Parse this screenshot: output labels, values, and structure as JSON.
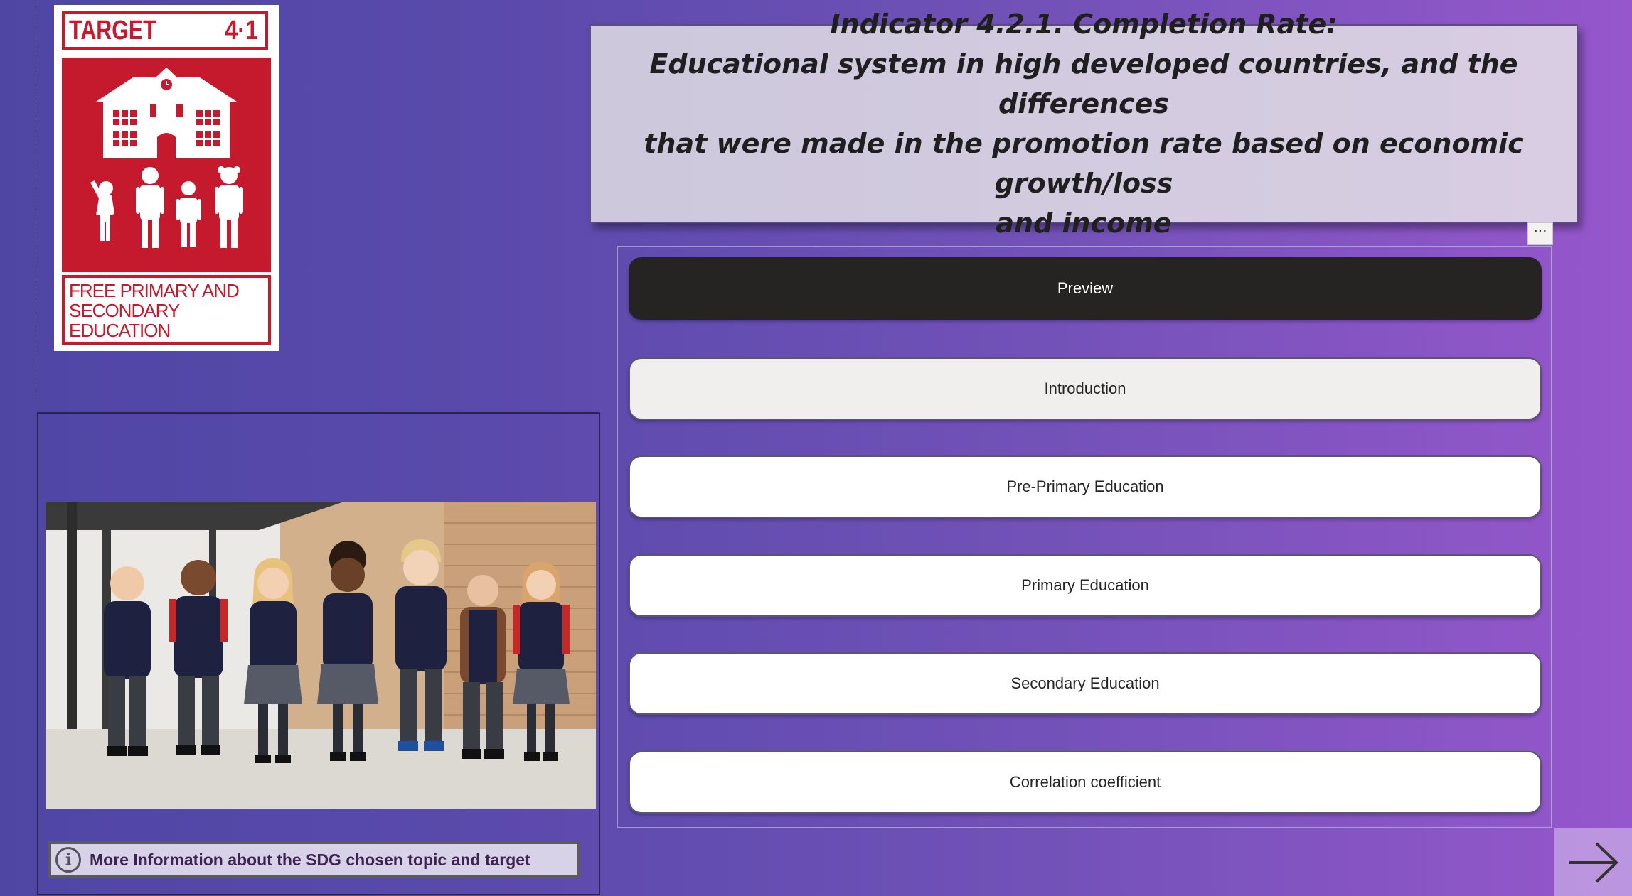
{
  "sdg_badge": {
    "target_label": "TARGET",
    "target_number": "4·1",
    "caption_lines": [
      "FREE PRIMARY AND",
      "SECONDARY",
      "EDUCATION"
    ]
  },
  "title": {
    "lines": [
      "Indicator 4.2.1. Completion Rate:",
      "Educational system in high developed countries, and the differences",
      "that were made in the promotion rate based on economic growth/loss",
      "and income"
    ]
  },
  "more_options_label": "···",
  "nav": {
    "buttons": [
      {
        "label": "Preview",
        "state": "selected"
      },
      {
        "label": "Introduction",
        "state": "hover"
      },
      {
        "label": "Pre-Primary Education",
        "state": "default"
      },
      {
        "label": "Primary Education",
        "state": "default"
      },
      {
        "label": "Secondary Education",
        "state": "default"
      },
      {
        "label": "Correlation coefficient",
        "state": "default"
      }
    ]
  },
  "info_button": {
    "label": "More Information about the SDG chosen topic and target",
    "icon": "info-icon"
  },
  "next_page": {
    "icon": "arrow-right-icon"
  },
  "colors": {
    "sdg_red": "#c5192d",
    "selected_button": "#252423",
    "title_background": "#cdc8dc"
  }
}
